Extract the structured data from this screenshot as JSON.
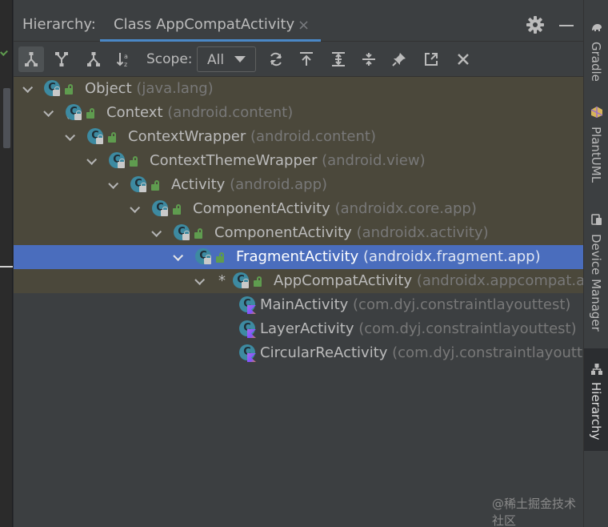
{
  "header": {
    "label": "Hierarchy:",
    "tab_label": "Class AppCompatActivity",
    "tab_close": "×"
  },
  "toolbar": {
    "scope_label": "Scope:",
    "scope_value": "All",
    "buttons": [
      "subtypes-hierarchy-icon",
      "supertypes-hierarchy-icon",
      "type-hierarchy-icon",
      "sort-alphabetically-icon",
      "refresh-icon",
      "export-icon",
      "expand-all-icon",
      "collapse-all-icon",
      "pin-icon",
      "open-in-new-icon",
      "close-icon"
    ]
  },
  "tree": [
    {
      "name": "Object",
      "pkg": "(java.lang)",
      "style": "olive",
      "mark": ""
    },
    {
      "name": "Context",
      "pkg": "(android.content)",
      "style": "olive",
      "mark": "("
    },
    {
      "name": "ContextWrapper",
      "pkg": "(android.content)",
      "style": "olive",
      "mark": ""
    },
    {
      "name": "ContextThemeWrapper",
      "pkg": "(android.view)",
      "style": "olive",
      "mark": ""
    },
    {
      "name": "Activity",
      "pkg": "(android.app)",
      "style": "olive",
      "mark": ""
    },
    {
      "name": "ComponentActivity",
      "pkg": "(androidx.core.app)",
      "style": "olive",
      "mark": ""
    },
    {
      "name": "ComponentActivity",
      "pkg": "(androidx.activity)",
      "style": "olive",
      "mark": ""
    },
    {
      "name": "FragmentActivity",
      "pkg": "(androidx.fragment.app)",
      "style": "selected",
      "mark": ""
    },
    {
      "name": "AppCompatActivity",
      "pkg": "(androidx.appcompat.ap",
      "style": "olive",
      "mark": "*"
    },
    {
      "name": "MainActivity",
      "pkg": "(com.dyj.constraintlayouttest)",
      "style": "plain",
      "mark": ""
    },
    {
      "name": "LayerActivity",
      "pkg": "(com.dyj.constraintlayouttest)",
      "style": "plain",
      "mark": ""
    },
    {
      "name": "CircularReActivity",
      "pkg": "(com.dyj.constraintlayouttes",
      "style": "plain",
      "mark": ""
    }
  ],
  "sidebar": {
    "items": [
      {
        "label": "Gradle",
        "icon": "gradle-elephant-icon",
        "active": false
      },
      {
        "label": "PlantUML",
        "icon": "plantuml-icon",
        "active": false
      },
      {
        "label": "Device Manager",
        "icon": "device-manager-icon",
        "active": false
      },
      {
        "label": "Hierarchy",
        "icon": "hierarchy-icon",
        "active": true
      }
    ]
  },
  "watermark": "@稀土掘金技术社区",
  "colors": {
    "accent": "#4a88c7",
    "selection": "#4a6dbd",
    "olive_row": "#4b483b",
    "class_icon": "#3d8aa1",
    "public_lock": "#5f9c4f"
  }
}
